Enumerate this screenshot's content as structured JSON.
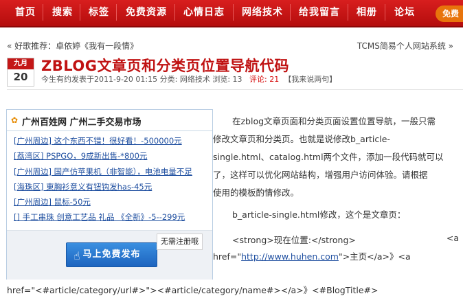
{
  "nav": {
    "items": [
      "首页",
      "搜索",
      "标签",
      "免费资源",
      "心情日志",
      "网络技术",
      "给我留言",
      "相册",
      "论坛"
    ],
    "corner": "免费"
  },
  "strip": {
    "left": "« 好歌推荐：卓依婷《我有一段情》",
    "right": "TCMS简易个人网站系统 »"
  },
  "post": {
    "month": "九月",
    "day": "20",
    "title": "ZBLOG文章页和分类页位置导航代码",
    "meta": "今生有约发表于2011-9-20 01:15   分类: 网络技术   浏览: 13",
    "comments": "评论: 21",
    "reply": "【我来说两句】"
  },
  "ad": {
    "header": "广州百姓网 广州二手交易市场",
    "items": [
      "[广州周边] 这个东西不错！很好看！-500000元",
      "[荔湾区] PSPGO，9成新出售-*800元",
      "[广州周边] 国产仿苹果机（非智能），电池电量不足",
      "[海珠区] 東胸衫意义有钮钩发has-45元",
      "[广州周边] 鼠标-50元",
      "[] 手工串珠  创意工艺品  礼品  《全新》-5--299元"
    ],
    "button": "马上免费发布",
    "note": "无需注册哦"
  },
  "content": {
    "para1_lines": [
      "在zblog文章页面和分类页面设置位置导航，一般只需",
      "修改文章页和分类页。也就是说修改b_article-",
      "single.html、catalog.html两个文件，添加一段代码就可以",
      "了，这样可以优化网站结构，增强用户访问体验。请根据",
      "使用的模板酌情修改。"
    ],
    "para2": "b_article-single.html修改，这个是文章页：",
    "para3_left": "<strong>现在位置:</strong>",
    "para3_right": "<a",
    "para4_prefix": "href=\"",
    "para4_link": "http://www.huhen.com",
    "para4_suffix": "\">主页</a>》<a",
    "para5": "href=\"<#article/category/url#>\"><#article/category/name#></a>》<#BlogTitle#>"
  }
}
